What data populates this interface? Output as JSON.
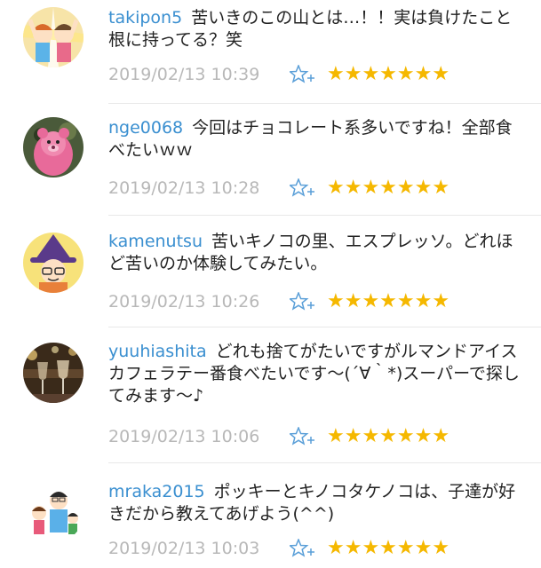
{
  "comments": [
    {
      "username": "takipon5",
      "text": "苦いきのこの山とは…！！実は負けたこと根に持ってる？笑",
      "timestamp": "2019/02/13 10:39",
      "stars": "★★★★★★★",
      "avatar": "kids-cheering-avatar"
    },
    {
      "username": "nge0068",
      "text": "今回はチョコレート系多いですね！全部食べたいｗｗ",
      "timestamp": "2019/02/13 10:28",
      "stars": "★★★★★★★",
      "avatar": "pink-bear-avatar"
    },
    {
      "username": "kamenutsu",
      "text": "苦いキノコの里、エスプレッソ。どれほど苦いのか体験してみたい。",
      "timestamp": "2019/02/13 10:26",
      "stars": "★★★★★★★",
      "avatar": "witch-avatar"
    },
    {
      "username": "yuuhiashita",
      "text": "どれも捨てがたいですがルマンドアイスカフェラテー番食べたいです〜(´∀｀*)スーパーで探してみます〜♪",
      "timestamp": "2019/02/13 10:06",
      "stars": "★★★★★★★",
      "avatar": "wine-glasses-avatar"
    },
    {
      "username": "mraka2015",
      "text": "ポッキーとキノコタケノコは、子達が好きだから教えてあげよう(^^)",
      "timestamp": "2019/02/13 10:03",
      "stars": "★★★★★★★",
      "avatar": "family-avatar"
    }
  ],
  "colors": {
    "username": "#3a8fd0",
    "timestamp": "#b8b8b8",
    "star": "#f5b800",
    "fav_icon": "#5a9fd8"
  },
  "icons": {
    "favorite_add": "star-plus-icon"
  }
}
